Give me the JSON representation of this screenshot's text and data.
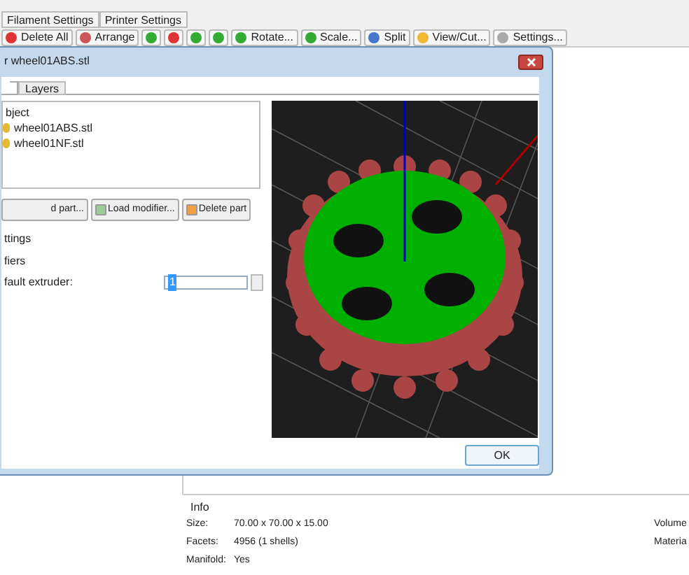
{
  "main_tabs": [
    {
      "label": "Filament Settings",
      "selected": false
    },
    {
      "label": "Printer Settings",
      "selected": false
    }
  ],
  "toolbar": [
    {
      "kind": "text",
      "label": "Delete All"
    },
    {
      "kind": "text",
      "label": "Arrange"
    },
    {
      "kind": "icon"
    },
    {
      "kind": "icon"
    },
    {
      "kind": "icon"
    },
    {
      "kind": "icon"
    },
    {
      "kind": "text",
      "label": "Rotate..."
    },
    {
      "kind": "text",
      "label": "Scale..."
    },
    {
      "kind": "text",
      "label": "Split"
    },
    {
      "kind": "text",
      "label": "View/Cut..."
    },
    {
      "kind": "text",
      "label": "Settings..."
    }
  ],
  "dialog": {
    "title": "r wheel01ABS.stl",
    "tabs": [
      {
        "label": "Layers",
        "selected": false
      }
    ],
    "tree": [
      {
        "label": "bject",
        "children": [
          {
            "label": "wheel01ABS.stl"
          },
          {
            "label": "wheel01NF.stl"
          }
        ]
      }
    ],
    "buttons": [
      "d part...",
      "Load modifier...",
      "Delete part"
    ],
    "settings": [
      "ttings",
      "fiers"
    ],
    "field": {
      "label": "fault extruder:",
      "value": "1"
    },
    "ok": "OK"
  },
  "info": {
    "title": "Info",
    "rows": [
      {
        "label": "Size:",
        "value": "70.00 x 70.00 x 15.00",
        "right": "Volume"
      },
      {
        "label": "Facets:",
        "value": "4956 (1 shells)",
        "right": "Materia"
      },
      {
        "label": "Manifold:",
        "value": "Yes"
      }
    ]
  }
}
